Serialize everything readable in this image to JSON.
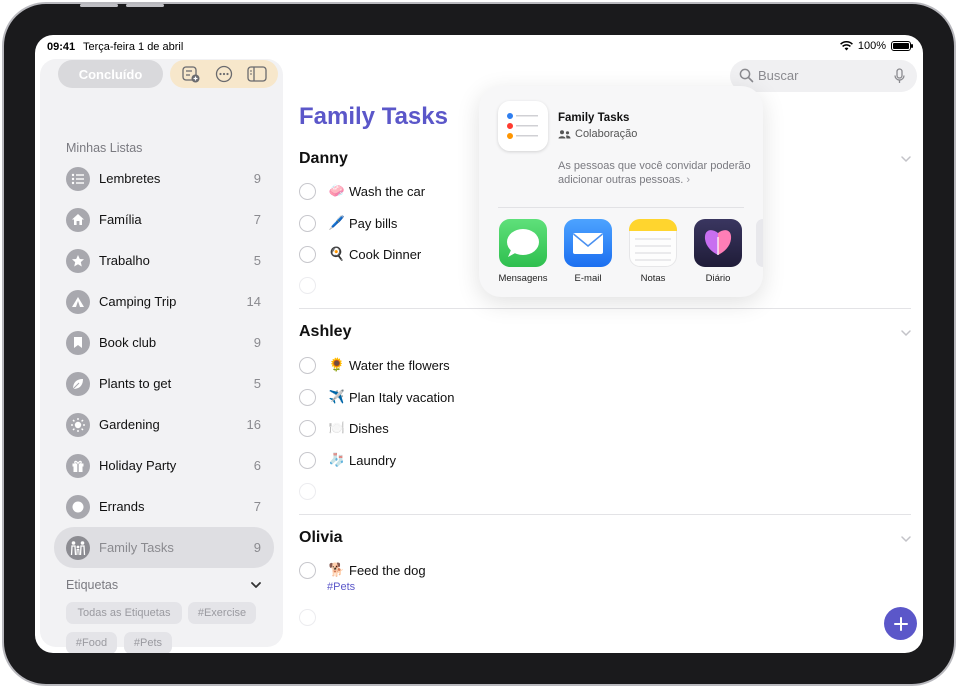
{
  "status": {
    "time": "09:41",
    "date": "Terça-feira 1 de abril",
    "battery": "100%"
  },
  "toolbar": {
    "done_label": "Concluído"
  },
  "sidebar": {
    "heading": "Minhas Listas",
    "items": [
      {
        "label": "Lembretes",
        "count": "9",
        "icon": "list-bullet-icon"
      },
      {
        "label": "Família",
        "count": "7",
        "icon": "house-icon"
      },
      {
        "label": "Trabalho",
        "count": "5",
        "icon": "star-icon"
      },
      {
        "label": "Camping Trip",
        "count": "14",
        "icon": "tent-icon"
      },
      {
        "label": "Book club",
        "count": "9",
        "icon": "bookmark-icon"
      },
      {
        "label": "Plants to get",
        "count": "5",
        "icon": "leaf-icon"
      },
      {
        "label": "Gardening",
        "count": "16",
        "icon": "sun-icon"
      },
      {
        "label": "Holiday Party",
        "count": "6",
        "icon": "gift-icon"
      },
      {
        "label": "Errands",
        "count": "7",
        "icon": "circle-icon"
      },
      {
        "label": "Family Tasks",
        "count": "9",
        "icon": "family-icon"
      }
    ],
    "tags_heading": "Etiquetas",
    "tags": [
      "Todas as Etiquetas",
      "#Exercise",
      "#Food",
      "#Pets"
    ]
  },
  "search": {
    "placeholder": "Buscar"
  },
  "main": {
    "title": "Family Tasks",
    "sections": [
      {
        "name": "Danny",
        "tasks": [
          {
            "emoji": "🧼",
            "label": "Wash the car"
          },
          {
            "emoji": "🖊️",
            "label": "Pay bills"
          },
          {
            "emoji": "🍳",
            "label": "Cook Dinner"
          }
        ]
      },
      {
        "name": "Ashley",
        "tasks": [
          {
            "emoji": "🌻",
            "label": "Water the flowers"
          },
          {
            "emoji": "✈️",
            "label": "Plan Italy vacation"
          },
          {
            "emoji": "🍽️",
            "label": "Dishes"
          },
          {
            "emoji": "🧦",
            "label": "Laundry"
          }
        ]
      },
      {
        "name": "Olivia",
        "tasks": [
          {
            "emoji": "🐕",
            "label": "Feed the dog",
            "tag": "#Pets"
          }
        ]
      }
    ]
  },
  "popover": {
    "title": "Family Tasks",
    "subtitle": "Colaboração",
    "description": "As pessoas que você convidar poderão adicionar outras pessoas.",
    "share_targets": [
      {
        "label": "Mensagens",
        "icon": "messages-icon"
      },
      {
        "label": "E-mail",
        "icon": "mail-icon"
      },
      {
        "label": "Notas",
        "icon": "notes-icon"
      },
      {
        "label": "Diário",
        "icon": "journal-icon"
      }
    ]
  },
  "colors": {
    "accent": "#5b57c9",
    "sidebar_bg": "#f2f2f4",
    "messages": "#34c759",
    "mail": "#2f7ff0"
  }
}
